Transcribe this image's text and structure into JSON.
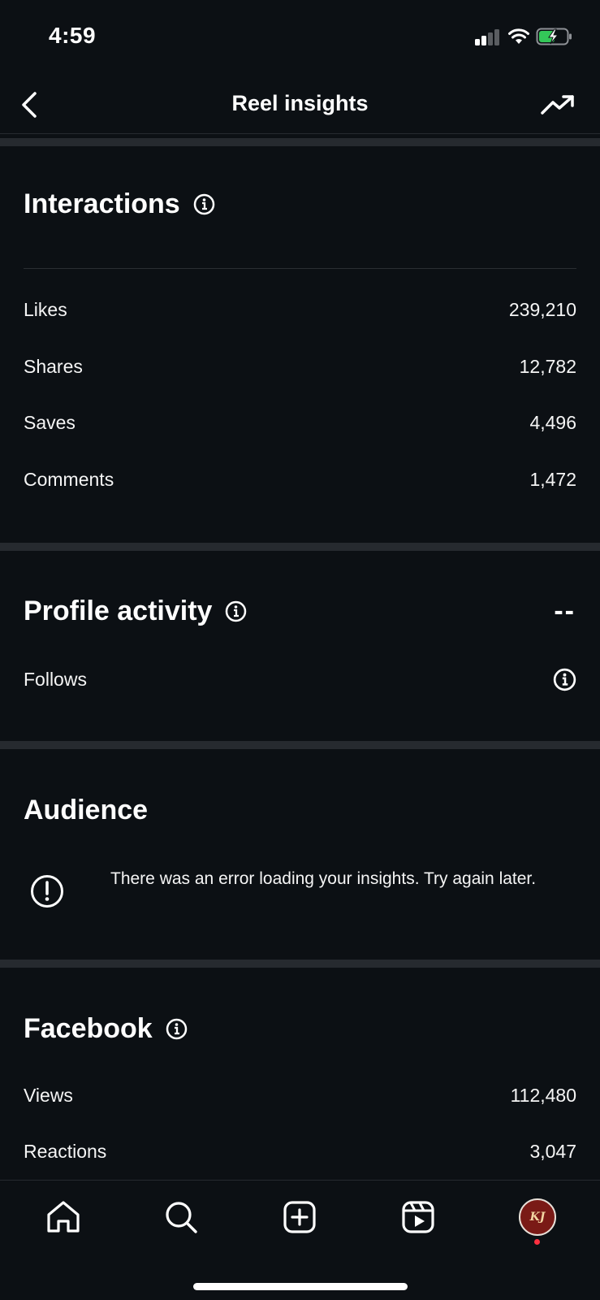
{
  "status_bar": {
    "time": "4:59"
  },
  "header": {
    "title": "Reel insights"
  },
  "interactions": {
    "title": "Interactions",
    "rows": [
      {
        "label": "Likes",
        "value": "239,210"
      },
      {
        "label": "Shares",
        "value": "12,782"
      },
      {
        "label": "Saves",
        "value": "4,496"
      },
      {
        "label": "Comments",
        "value": "1,472"
      }
    ]
  },
  "profile_activity": {
    "title": "Profile activity",
    "value": "--",
    "rows": [
      {
        "label": "Follows"
      }
    ]
  },
  "audience": {
    "title": "Audience",
    "error_message": "There was an error loading your insights. Try again later."
  },
  "facebook": {
    "title": "Facebook",
    "rows": [
      {
        "label": "Views",
        "value": "112,480"
      },
      {
        "label": "Reactions",
        "value": "3,047"
      }
    ]
  },
  "bottom_nav": {
    "items": [
      "home-icon",
      "search-icon",
      "create-icon",
      "reels-icon",
      "profile-avatar"
    ],
    "avatar_initials": "KJ"
  },
  "colors": {
    "background": "#0c1014",
    "divider": "#262a2f",
    "text": "#f5f5f5",
    "battery": "#34c759",
    "notification": "#ff3040"
  }
}
